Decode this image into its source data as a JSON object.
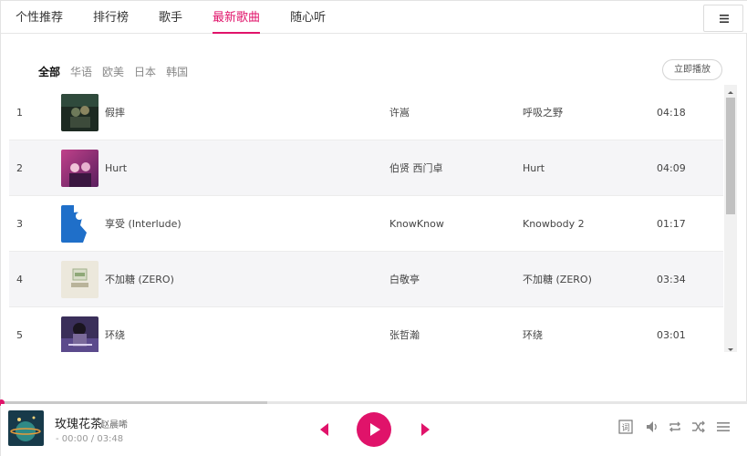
{
  "tabs": [
    "个性推荐",
    "排行榜",
    "歌手",
    "最新歌曲",
    "随心听"
  ],
  "active_tab": 3,
  "filters": [
    "全部",
    "华语",
    "欧美",
    "日本",
    "韩国"
  ],
  "active_filter": 0,
  "play_all_label": "立即播放",
  "songs": [
    {
      "num": "1",
      "title": "假摔",
      "artist": "许嵩",
      "album": "呼吸之野",
      "duration": "04:18",
      "cover": "cover-dark-green"
    },
    {
      "num": "2",
      "title": "Hurt",
      "artist": "伯贤 西门卓",
      "album": "Hurt",
      "duration": "04:09",
      "cover": "cover-pink-purple"
    },
    {
      "num": "3",
      "title": "享受 (Interlude)",
      "artist": "KnowKnow",
      "album": "Knowbody 2",
      "duration": "01:17",
      "cover": "cover-blue-figure"
    },
    {
      "num": "4",
      "title": "不加糖 (ZERO)",
      "artist": "白敬亭",
      "album": "不加糖 (ZERO)",
      "duration": "03:34",
      "cover": "cover-beige-stamp"
    },
    {
      "num": "5",
      "title": "环绕",
      "artist": "张哲瀚",
      "album": "环绕",
      "duration": "03:01",
      "cover": "cover-portrait-purple"
    }
  ],
  "now_playing": {
    "title": "玫瑰花茶",
    "artist": "赵晨唏",
    "time": "- 00:00 / 03:48",
    "cover": "cover-teal-planet"
  },
  "progress_fraction": 0.0,
  "icons": {
    "menu": "hamburger-icon",
    "prev": "previous-icon",
    "play": "play-icon",
    "next": "next-icon",
    "lyrics": "lyrics-icon",
    "volume": "volume-icon",
    "repeat": "repeat-icon",
    "shuffle": "shuffle-icon",
    "playlist": "playlist-icon"
  },
  "colors": {
    "accent": "#e0136a",
    "text": "#333333",
    "alt_row": "#f5f5f7"
  }
}
